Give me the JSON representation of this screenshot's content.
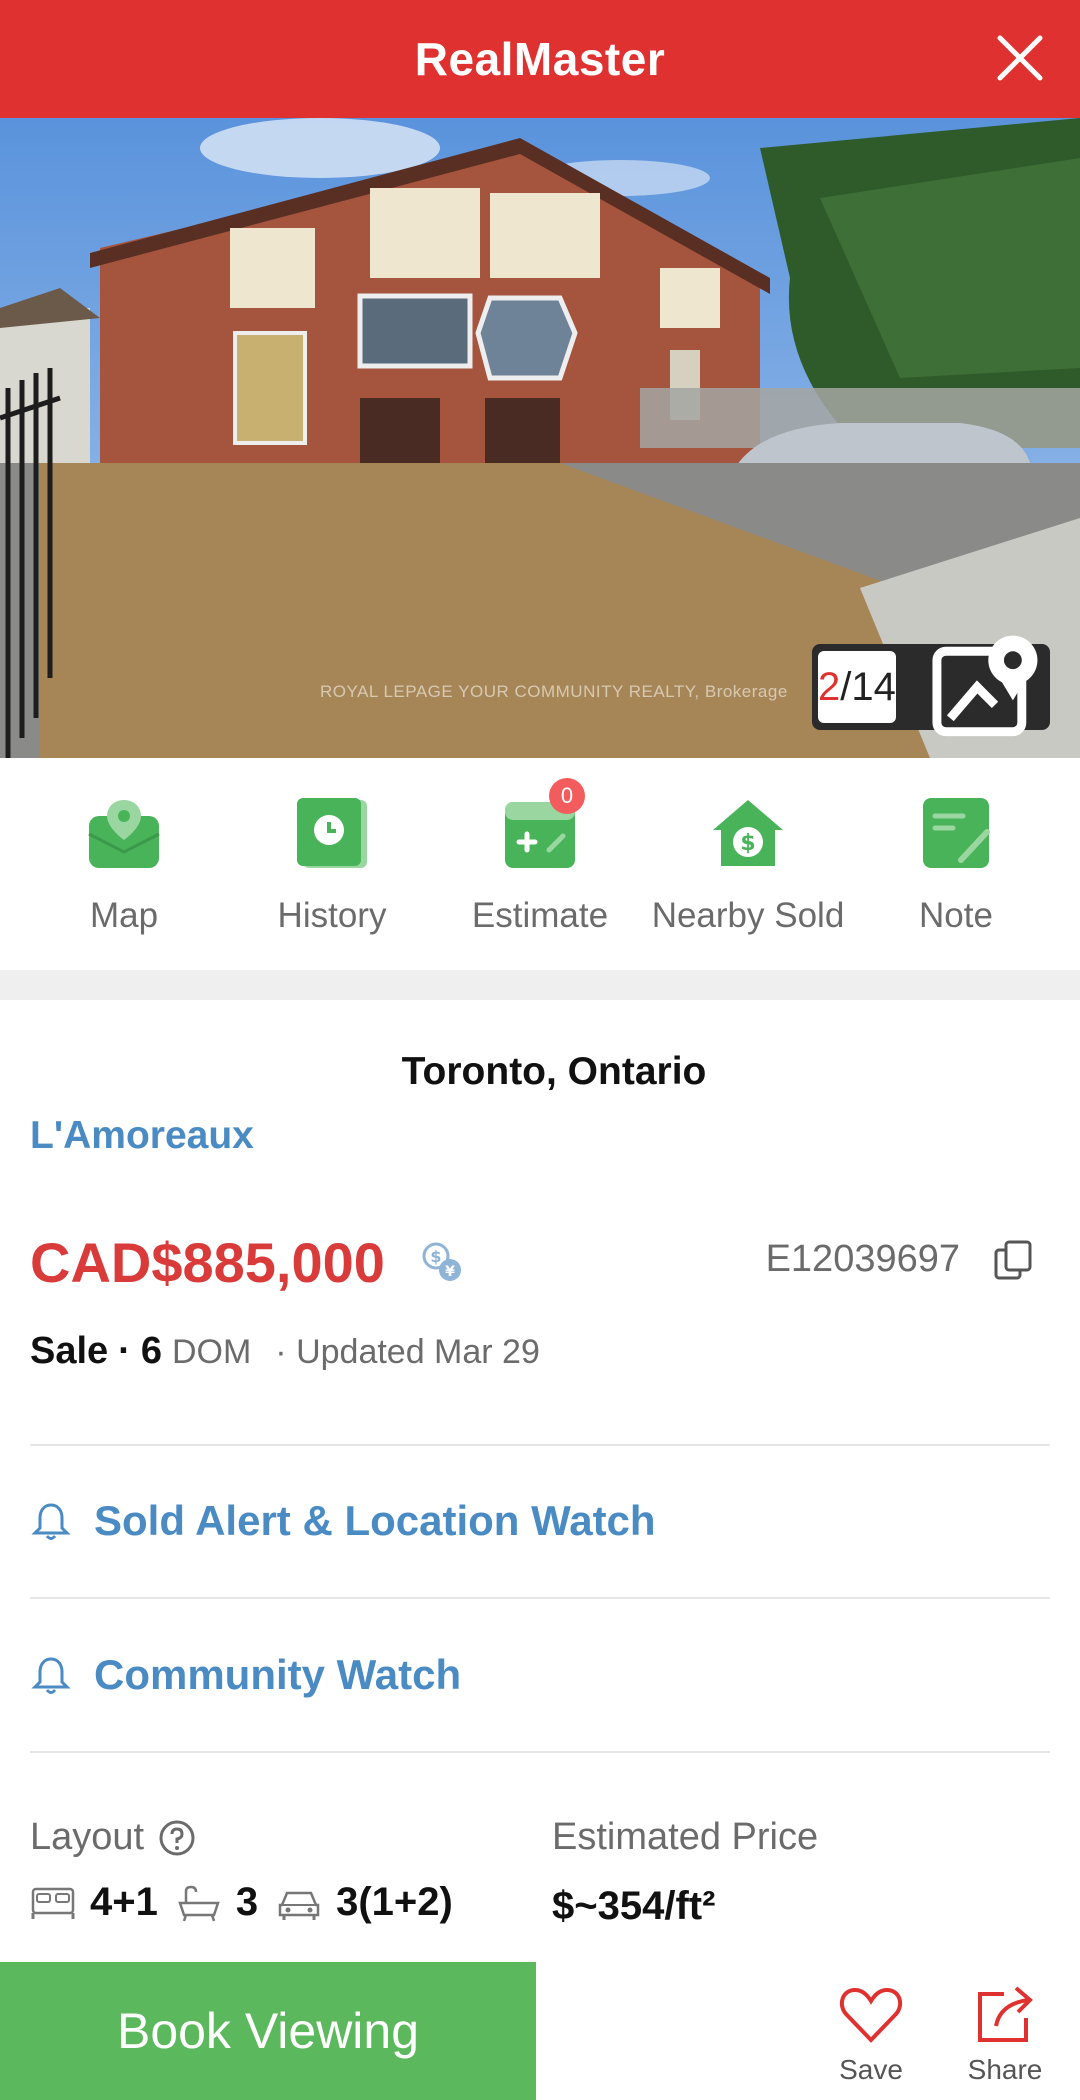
{
  "header": {
    "title": "RealMaster",
    "close_icon": "close-icon"
  },
  "photo": {
    "counter_current": "2",
    "counter_total": "/14",
    "watermark": "ROYAL LEPAGE YOUR COMMUNITY REALTY, Brokerage"
  },
  "actions": [
    {
      "label": "Map",
      "icon": "map-icon"
    },
    {
      "label": "History",
      "icon": "history-icon"
    },
    {
      "label": "Estimate",
      "icon": "estimate-icon",
      "badge": "0"
    },
    {
      "label": "Nearby Sold",
      "icon": "nearby-sold-icon"
    },
    {
      "label": "Note",
      "icon": "note-icon"
    }
  ],
  "listing": {
    "city": "Toronto, Ontario",
    "community": "L'Amoreaux",
    "price": "CAD$885,000",
    "id": "E12039697",
    "status": "Sale",
    "dot": "·",
    "dom": "6",
    "dom_unit": "DOM",
    "updated": "· Updated Mar 29"
  },
  "watches": {
    "sold_alert": "Sold Alert & Location Watch",
    "community": "Community Watch"
  },
  "details": {
    "layout_title": "Layout",
    "beds": "4+1",
    "baths": "3",
    "parking": "3(1+2)",
    "estimated_title": "Estimated Price",
    "estimated_value": "$~354/ft²"
  },
  "bottom": {
    "book_label": "Book Viewing",
    "save_label": "Save",
    "share_label": "Share"
  },
  "colors": {
    "brand_red": "#e03131",
    "link_blue": "#4a8bc4",
    "action_green": "#5cb85c",
    "price_red": "#d93a3a"
  }
}
